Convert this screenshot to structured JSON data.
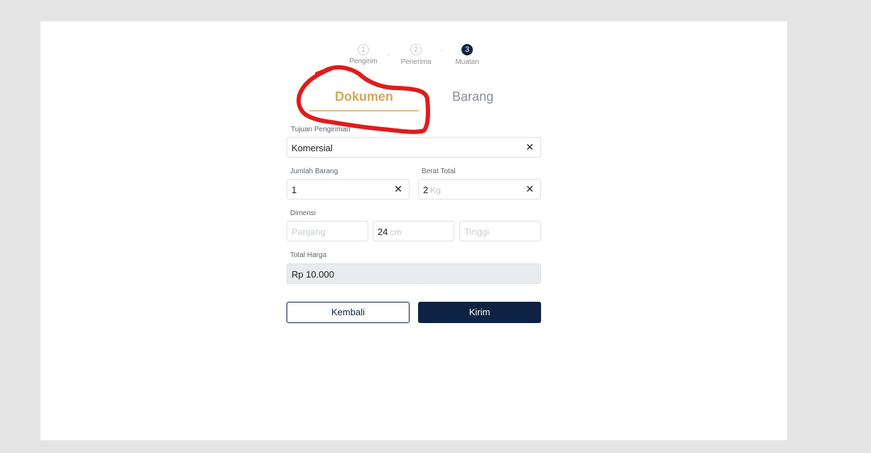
{
  "stepper": {
    "steps": [
      {
        "number": "1",
        "label": "Pengirim",
        "state": "done"
      },
      {
        "number": "2",
        "label": "Penerima",
        "state": "done"
      },
      {
        "number": "3",
        "label": "Muatan",
        "state": "active"
      }
    ],
    "separator": "-"
  },
  "tabs": [
    {
      "label": "Dokumen",
      "active": true
    },
    {
      "label": "Barang",
      "active": false
    }
  ],
  "form": {
    "tujuan": {
      "label": "Tujuan Pengiriman",
      "value": "Komersial"
    },
    "jumlah": {
      "label": "Jumlah Barang",
      "value": "1"
    },
    "berat": {
      "label": "Berat Total",
      "value": "2",
      "unit": "Kg"
    },
    "dimensi": {
      "label": "Dimensi",
      "panjang_placeholder": "Panjang",
      "lebar_value": "24",
      "lebar_unit": "cm",
      "tinggi_placeholder": "Tinggi"
    },
    "total": {
      "label": "Total Harga",
      "value": "Rp 10.000"
    },
    "clear_symbol": "✕"
  },
  "buttons": {
    "back": "Kembali",
    "submit": "Kirim"
  },
  "colors": {
    "primary": "#0e2243",
    "accent_gold": "#cfa957",
    "annotation_red": "#e11b1b",
    "background": "#e5e5e5"
  }
}
